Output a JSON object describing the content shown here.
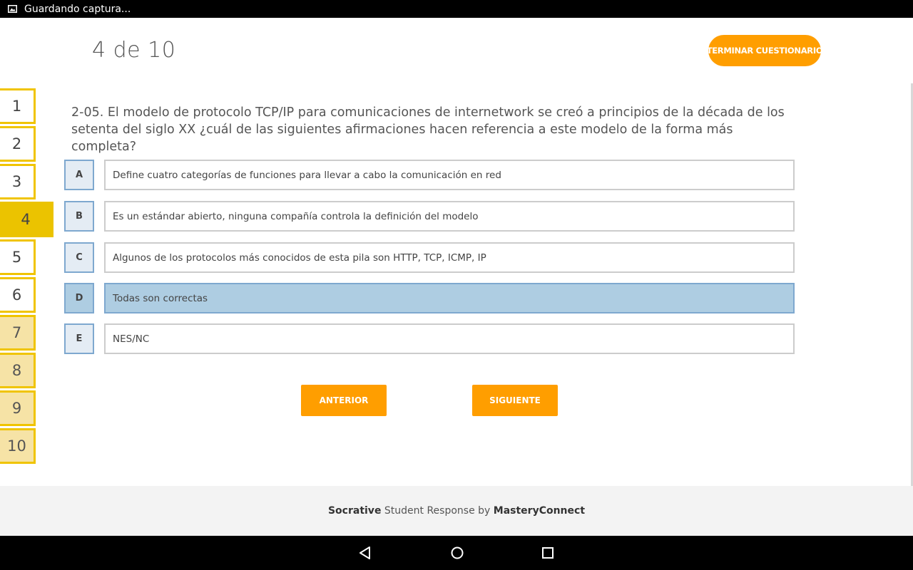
{
  "status_bar": {
    "notification": "Guardando captura...",
    "notification_icon": "image-icon"
  },
  "header": {
    "progress": "4 de 10",
    "finish_label": "TERMINAR CUESTIONARIO"
  },
  "question_nav": {
    "items": [
      {
        "label": "1",
        "state": "unanswered"
      },
      {
        "label": "2",
        "state": "unanswered"
      },
      {
        "label": "3",
        "state": "unanswered"
      },
      {
        "label": "4",
        "state": "current"
      },
      {
        "label": "5",
        "state": "unanswered"
      },
      {
        "label": "6",
        "state": "unanswered"
      },
      {
        "label": "7",
        "state": "answered"
      },
      {
        "label": "8",
        "state": "answered"
      },
      {
        "label": "9",
        "state": "answered"
      },
      {
        "label": "10",
        "state": "answered"
      }
    ]
  },
  "question": {
    "text": "2-05. El modelo de protocolo TCP/IP para comunicaciones de internetwork se creó a principios de la década de los setenta del siglo XX ¿cuál de las siguientes afirmaciones hacen referencia a este modelo de la forma más completa?",
    "answers": [
      {
        "letter": "A",
        "text": "Define cuatro categorías de funciones para llevar a cabo la comunicación en red",
        "selected": false
      },
      {
        "letter": "B",
        "text": "Es un estándar abierto, ninguna compañía controla la definición del modelo",
        "selected": false
      },
      {
        "letter": "C",
        "text": "Algunos de los protocolos más conocidos de esta pila son HTTP, TCP, ICMP, IP",
        "selected": false
      },
      {
        "letter": "D",
        "text": "Todas son correctas",
        "selected": true
      },
      {
        "letter": "E",
        "text": "NES/NC",
        "selected": false
      }
    ]
  },
  "navigation": {
    "previous_label": "ANTERIOR",
    "next_label": "SIGUIENTE"
  },
  "footer": {
    "brand": "Socrative",
    "middle": " Student Response by ",
    "company": "MasteryConnect"
  },
  "colors": {
    "accent": "#ff9e00",
    "nav_border": "#f0c400",
    "selected_answer": "#aecde2"
  },
  "system_nav": {
    "icons": [
      "back-icon",
      "home-icon",
      "recents-icon"
    ]
  }
}
